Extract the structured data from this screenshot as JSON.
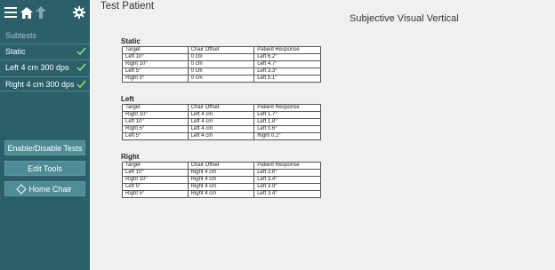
{
  "patient_name": "Test Patient",
  "page_title": "Subjective Visual Vertical",
  "sidebar": {
    "subtests_label": "Subtests",
    "items": [
      {
        "label": "Static"
      },
      {
        "label": "Left 4 cm 300 dps"
      },
      {
        "label": "Right 4 cm 300 dps"
      }
    ],
    "buttons": {
      "enable_disable": "Enable/Disable Tests",
      "edit_tools": "Edit Tools",
      "home_chair": "Home Chair"
    }
  },
  "colors": {
    "sidebar_bg": "#2c5f6a",
    "check": "#7ad46a",
    "button_bg": "#4f8c95"
  },
  "columns": [
    "Target",
    "Chair Offset",
    "Patient Response"
  ],
  "sections": [
    {
      "name": "Static",
      "rows": [
        [
          "Left 10°",
          "0 cm",
          "Left 6.2°"
        ],
        [
          "Right 10°",
          "0 cm",
          "Left 4.7°"
        ],
        [
          "Left 5°",
          "0 cm",
          "Left 3.3°"
        ],
        [
          "Right 5°",
          "0 cm",
          "Left 5.1°"
        ]
      ]
    },
    {
      "name": "Left",
      "rows": [
        [
          "Right 10°",
          "Left 4 cm",
          "Left 1.7°"
        ],
        [
          "Left 10°",
          "Left 4 cm",
          "Left 1.8°"
        ],
        [
          "Right 5°",
          "Left 4 cm",
          "Left 0.6°"
        ],
        [
          "Left 5°",
          "Left 4 cm",
          "Right 0.2°"
        ]
      ]
    },
    {
      "name": "Right",
      "rows": [
        [
          "Left 10°",
          "Right 4 cm",
          "Left 3.6°"
        ],
        [
          "Right 10°",
          "Right 4 cm",
          "Left 3.4°"
        ],
        [
          "Left 5°",
          "Right 4 cm",
          "Left 3.9°"
        ],
        [
          "Right 5°",
          "Right 4 cm",
          "Left 3.4°"
        ]
      ]
    }
  ]
}
